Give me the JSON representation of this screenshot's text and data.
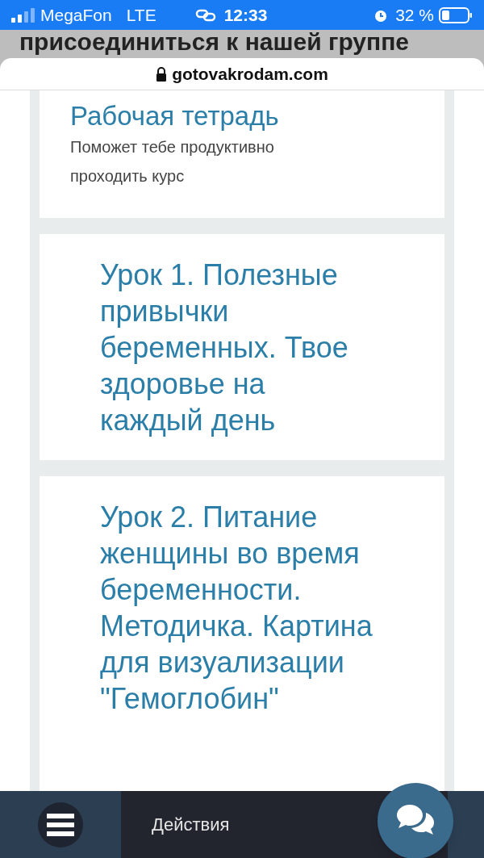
{
  "status_bar": {
    "carrier": "MegaFon",
    "network": "LTE",
    "time": "12:33",
    "battery": "32 %"
  },
  "page_heading": "присоединиться к нашей группе",
  "address_bar": {
    "url": "gotovakrodam.com"
  },
  "cards": [
    {
      "title": "Рабочая тетрадь",
      "subtitle": "Поможет тебе продуктивно проходить курс"
    },
    {
      "title": "Урок 1. Полезные привычки беременных. Твое здоровье на каждый день"
    },
    {
      "title": "Урок 2. Питание женщины во время беременности. Методичка. Картина для визуализации \"Гемоглобин\""
    }
  ],
  "bottom_bar": {
    "actions_label": "Действия"
  }
}
